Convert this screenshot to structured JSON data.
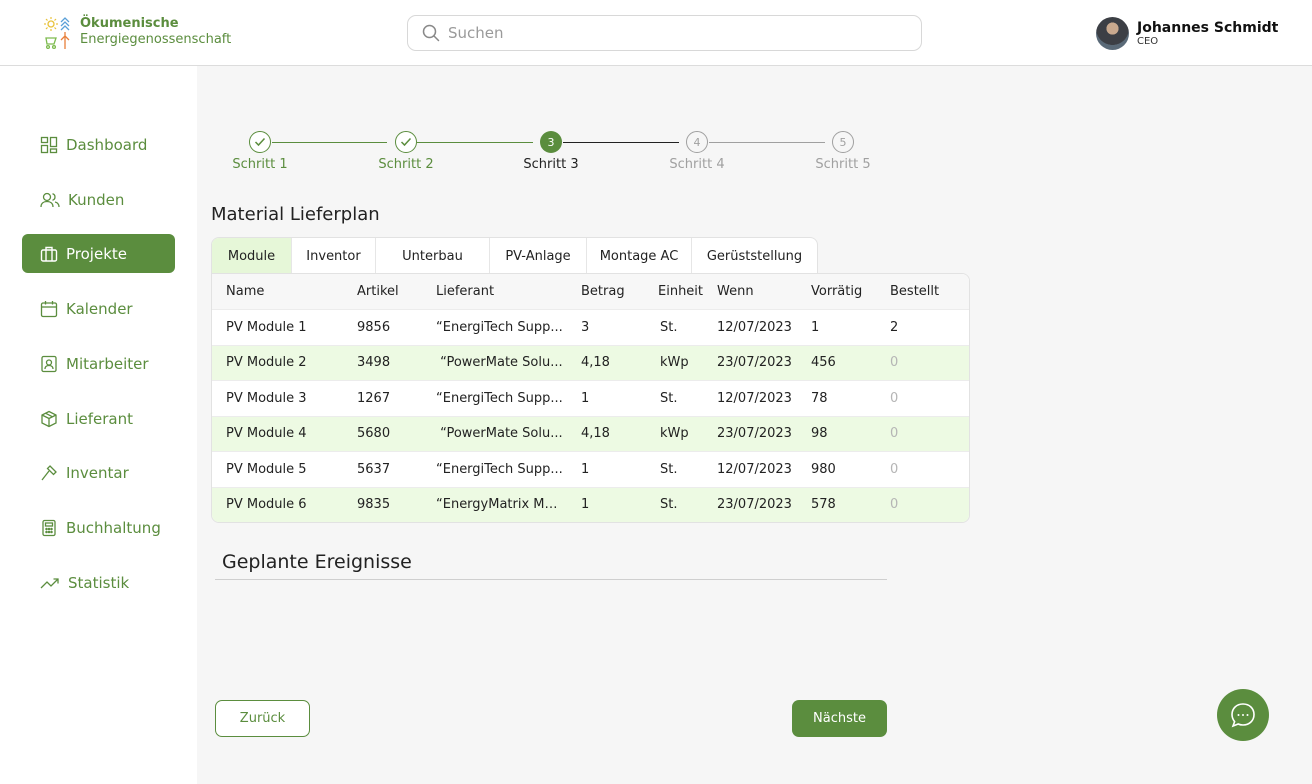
{
  "brand": {
    "line1": "Ökumenische",
    "line2": "Energiegenossenschaft",
    "color": "#5b8d3e"
  },
  "search": {
    "placeholder": "Suchen"
  },
  "user": {
    "name": "Johannes Schmidt",
    "role": "CEO"
  },
  "sidebar": {
    "items": [
      {
        "label": "Dashboard",
        "icon": "dashboard-icon",
        "active": false
      },
      {
        "label": "Kunden",
        "icon": "users-icon",
        "active": false
      },
      {
        "label": "Projekte",
        "icon": "briefcase-icon",
        "active": true
      },
      {
        "label": "Kalender",
        "icon": "calendar-icon",
        "active": false
      },
      {
        "label": "Mitarbeiter",
        "icon": "badge-icon",
        "active": false
      },
      {
        "label": "Lieferant",
        "icon": "box-icon",
        "active": false
      },
      {
        "label": "Inventar",
        "icon": "hammer-icon",
        "active": false
      },
      {
        "label": "Buchhaltung",
        "icon": "calculator-icon",
        "active": false
      },
      {
        "label": "Statistik",
        "icon": "trend-icon",
        "active": false
      }
    ]
  },
  "stepper": {
    "steps": [
      {
        "label": "Schritt 1",
        "state": "done",
        "num": "1"
      },
      {
        "label": "Schritt 2",
        "state": "done",
        "num": "2"
      },
      {
        "label": "Schritt 3",
        "state": "current",
        "num": "3"
      },
      {
        "label": "Schritt 4",
        "state": "todo",
        "num": "4"
      },
      {
        "label": "Schritt 5",
        "state": "todo",
        "num": "5"
      }
    ]
  },
  "material": {
    "title": "Material Lieferplan",
    "tabs": [
      "Module",
      "Inventor",
      "Unterbau",
      "PV-Anlage",
      "Montage AC",
      "Gerüststellung"
    ],
    "active_tab": "Module",
    "columns": [
      "Name",
      "Artikel",
      "Lieferant",
      "Betrag",
      "Einheit",
      "Wenn",
      "Vorrätig",
      "Bestellt"
    ],
    "rows": [
      [
        "PV Module 1",
        "9856",
        "“EnergiTech Supp...",
        "3",
        "St.",
        "12/07/2023",
        "1",
        "2"
      ],
      [
        "PV Module 2",
        "3498",
        " “PowerMate Solu...",
        "4,18",
        "kWp",
        "23/07/2023",
        "456",
        "0"
      ],
      [
        "PV Module 3",
        "1267",
        "“EnergiTech Supp...",
        "1",
        "St.",
        "12/07/2023",
        "78",
        "0"
      ],
      [
        "PV Module 4",
        "5680",
        " “PowerMate Solu...",
        "4,18",
        "kWp",
        "23/07/2023",
        "98",
        "0"
      ],
      [
        "PV Module 5",
        "5637",
        "“EnergiTech Supp...",
        "1",
        "St.",
        "12/07/2023",
        "980",
        "0"
      ],
      [
        "PV Module 6",
        "9835",
        "“EnergyMatrix Ma...",
        "1",
        "St.",
        "23/07/2023",
        "578",
        "0"
      ]
    ]
  },
  "events": {
    "title": "Geplante Ereignisse"
  },
  "buttons": {
    "back": "Zurück",
    "next": "Nächste"
  },
  "chat": {
    "icon": "chat-icon"
  }
}
